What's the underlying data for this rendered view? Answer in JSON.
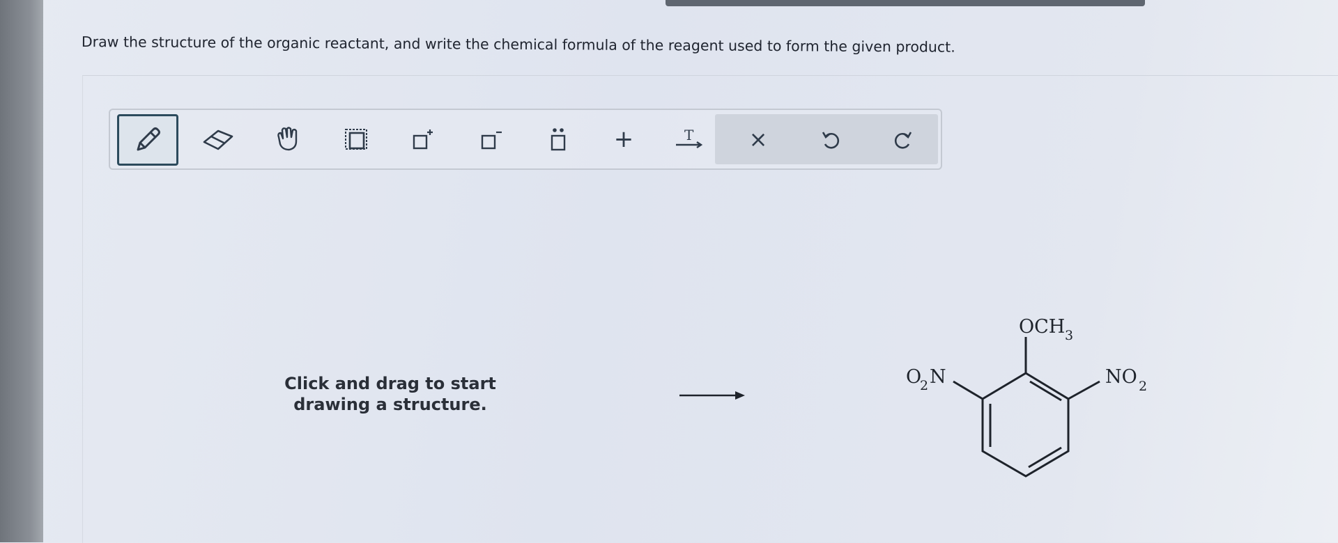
{
  "question": {
    "prompt": "Draw the structure of the organic reactant, and write the chemical formula of the reagent used to form the given product."
  },
  "toolbar": {
    "tools": [
      {
        "name": "draw",
        "icon": "pencil-icon",
        "selected": true
      },
      {
        "name": "erase",
        "icon": "eraser-icon"
      },
      {
        "name": "move",
        "icon": "hand-icon"
      },
      {
        "name": "select",
        "icon": "selection-box-icon"
      },
      {
        "name": "add-positive-charge",
        "icon": "positive-charge-icon"
      },
      {
        "name": "add-negative-charge",
        "icon": "negative-charge-icon"
      },
      {
        "name": "add-lone-pair",
        "icon": "lone-pair-icon"
      },
      {
        "name": "add",
        "icon": "plus-icon"
      },
      {
        "name": "reagent-text",
        "icon": "text-arrow-icon"
      },
      {
        "name": "clear",
        "icon": "close-icon"
      },
      {
        "name": "undo",
        "icon": "undo-icon"
      },
      {
        "name": "redo",
        "icon": "redo-icon"
      }
    ],
    "text_arrow_glyph": "T",
    "plus_glyph": "+",
    "close_glyph": "×"
  },
  "canvas": {
    "hint_line1": "Click and drag to start",
    "hint_line2": "drawing a structure."
  },
  "product": {
    "top_group": "OCH",
    "top_group_sub": "3",
    "left_group_main": "O",
    "left_group_sub": "2",
    "left_group_tail": "N",
    "right_group": "NO",
    "right_group_sub": "2"
  },
  "colors": {
    "accent_border": "#2c4a5c",
    "text": "#202530"
  }
}
